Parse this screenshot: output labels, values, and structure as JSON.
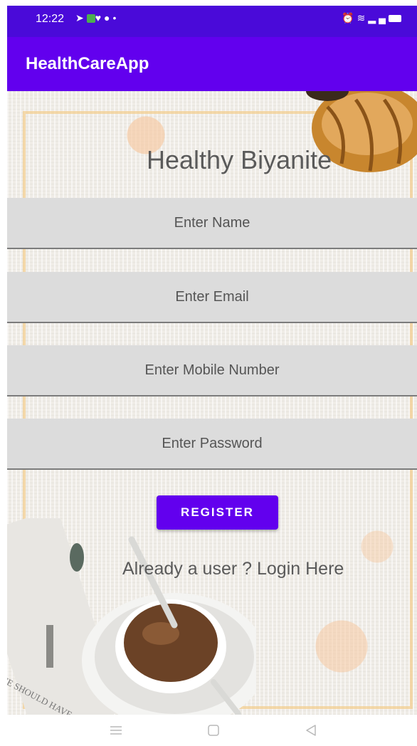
{
  "status_bar": {
    "time": "12:22",
    "left_icons": [
      "telegram-icon",
      "app-icon",
      "location-icon",
      "circle-icon",
      "dot-icon"
    ],
    "right_icons": [
      "alarm-icon",
      "wifi-icon",
      "signal-icon",
      "battery-icon"
    ],
    "background": "#4a0ad9"
  },
  "app_bar": {
    "title": "HealthCareApp",
    "background": "#6200ee"
  },
  "form": {
    "heading": "Healthy Biyanite",
    "name_placeholder": "Enter Name",
    "email_placeholder": "Enter Email",
    "mobile_placeholder": "Enter Mobile Number",
    "password_placeholder": "Enter Password",
    "register_label": "REGISTER",
    "login_link": "Already a user ? Login Here"
  },
  "nav_bar": {
    "buttons": [
      "menu-icon",
      "home-square-icon",
      "back-triangle-icon"
    ]
  },
  "colors": {
    "accent": "#6200ee",
    "field_bg": "#dcdcdc",
    "text_gray": "#5a5a5a"
  }
}
